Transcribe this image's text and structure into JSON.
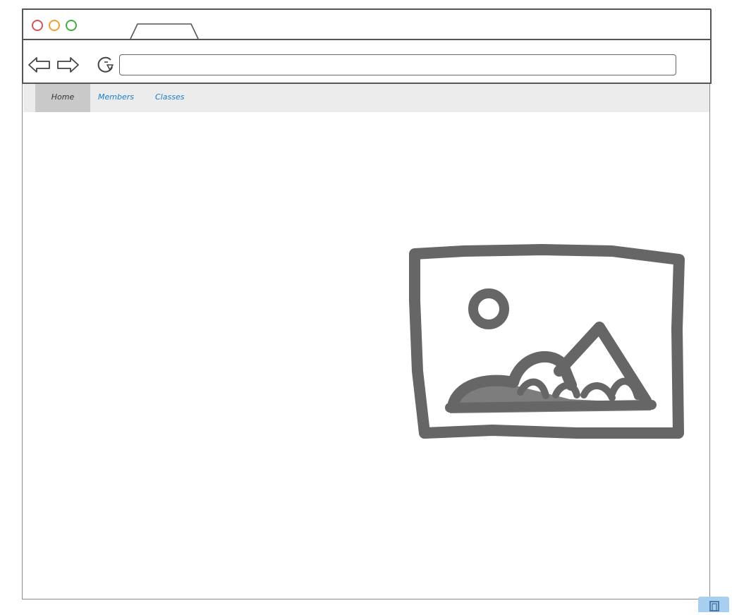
{
  "window": {
    "controls": [
      "close",
      "minimize",
      "maximize"
    ],
    "control_colors": {
      "close": "#d9534f",
      "minimize": "#f0a030",
      "maximize": "#3cb043"
    }
  },
  "browser": {
    "back_icon": "arrow-left-icon",
    "forward_icon": "arrow-right-icon",
    "reload_icon": "reload-icon",
    "url_value": ""
  },
  "nav": {
    "items": [
      {
        "label": "Home",
        "active": true
      },
      {
        "label": "Members",
        "active": false
      },
      {
        "label": "Classes",
        "active": false
      }
    ],
    "link_color": "#1a7fd0"
  },
  "content": {
    "image_icon": "image-placeholder-icon"
  }
}
